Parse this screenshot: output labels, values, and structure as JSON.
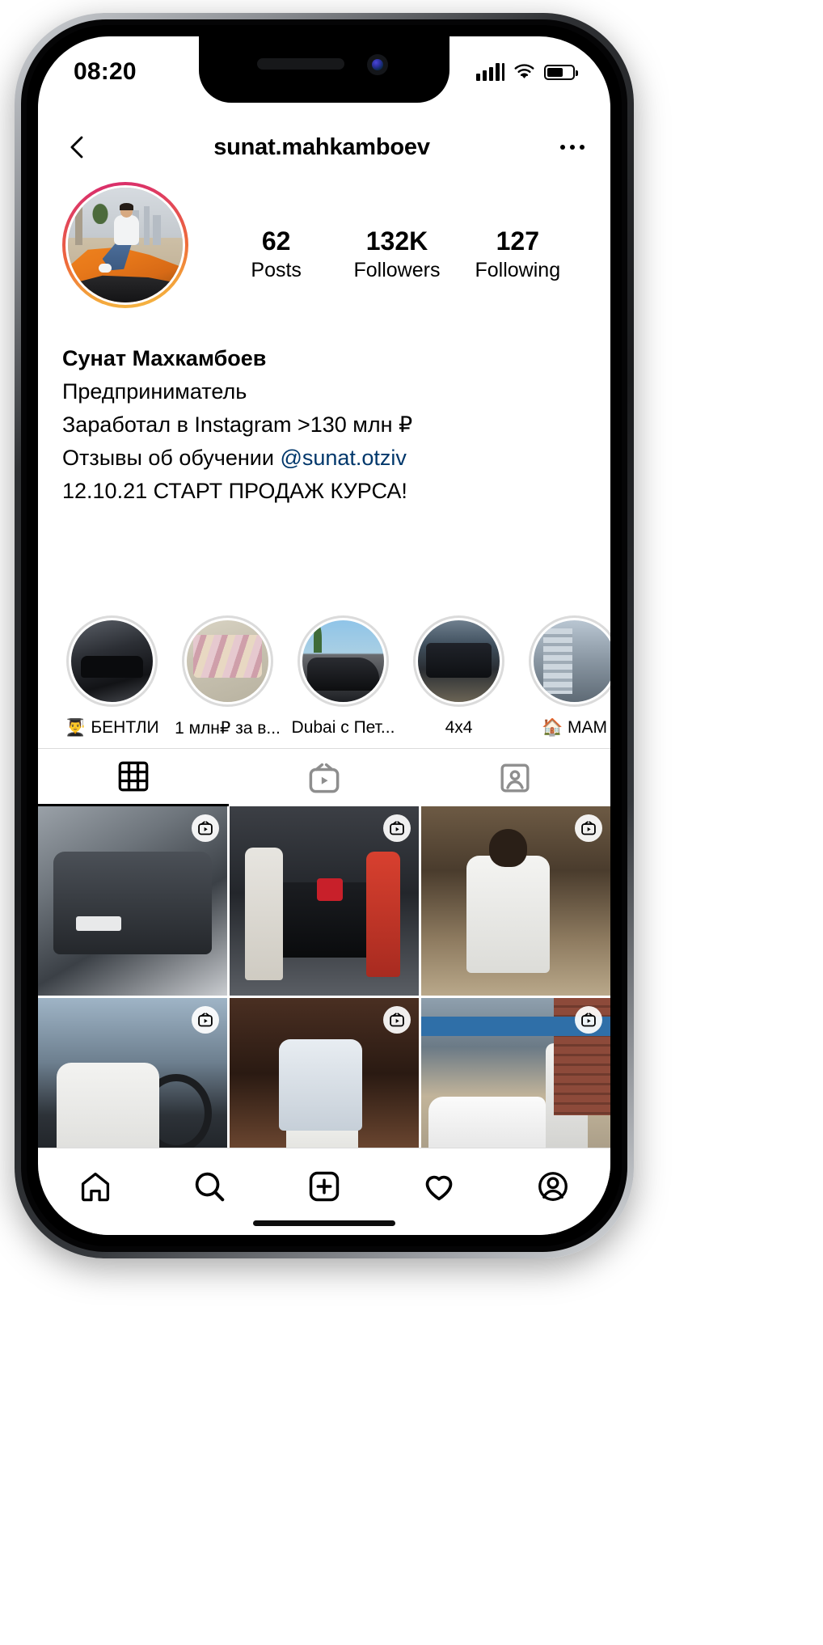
{
  "statusbar": {
    "time": "08:20",
    "cell_icon": "cellular-signal-icon",
    "wifi_icon": "wifi-icon",
    "battery_icon": "battery-icon",
    "battery_level": 62
  },
  "nav": {
    "back_icon": "back-chevron-icon",
    "title": "sunat.mahkamboev",
    "more_icon": "more-options-icon"
  },
  "profile": {
    "avatar_name": "profile-avatar",
    "has_story_ring": true,
    "ring_colors": [
      "#d6266f",
      "#ee6a3a",
      "#f6bb44"
    ],
    "stats": [
      {
        "value": "62",
        "label": "Posts"
      },
      {
        "value": "132K",
        "label": "Followers"
      },
      {
        "value": "127",
        "label": "Following"
      }
    ],
    "bio": {
      "name": "Сунат Махкамбоев",
      "lines": [
        "Предприниматель",
        "Заработал в Instagram >130 млн ₽"
      ],
      "mention_line_prefix": "Отзывы об обучении ",
      "mention": "@sunat.otziv",
      "mention_color": "#00376b",
      "last_line": "12.10.21 СТАРТ ПРОДАЖ КУРСА!"
    }
  },
  "highlights": [
    {
      "label": "👨‍🎓 БЕНТЛИ",
      "thumb": "bentley-car-thumb"
    },
    {
      "label": "1 млн₽ за в...",
      "thumb": "money-cash-thumb"
    },
    {
      "label": "Dubai с Пет...",
      "thumb": "dubai-rolls-royce-thumb"
    },
    {
      "label": "4x4",
      "thumb": "offroad-suv-thumb"
    },
    {
      "label": "🏠 МАМ",
      "thumb": "buildings-thumb"
    }
  ],
  "tabs": [
    {
      "name": "grid-tab",
      "icon": "grid-icon",
      "active": true
    },
    {
      "name": "igtv-tab",
      "icon": "igtv-icon",
      "active": false
    },
    {
      "name": "tagged-tab",
      "icon": "tagged-person-icon",
      "active": false
    }
  ],
  "grid_posts": [
    {
      "art": "p1",
      "alt": "gray-bmw-suv-post",
      "is_reel": true
    },
    {
      "art": "p2",
      "alt": "two-men-mercedes-gift-post",
      "is_reel": true
    },
    {
      "art": "p3",
      "alt": "man-white-shirt-restaurant-post",
      "is_reel": true
    },
    {
      "art": "p4",
      "alt": "man-driving-car-post",
      "is_reel": true
    },
    {
      "art": "p5",
      "alt": "man-white-jacket-sitting-post",
      "is_reel": true
    },
    {
      "art": "p6",
      "alt": "man-white-car-outdoors-post",
      "is_reel": true
    }
  ],
  "bottom_nav": [
    {
      "name": "home-icon"
    },
    {
      "name": "search-icon"
    },
    {
      "name": "add-post-icon"
    },
    {
      "name": "activity-heart-icon"
    },
    {
      "name": "profile-account-icon"
    }
  ]
}
